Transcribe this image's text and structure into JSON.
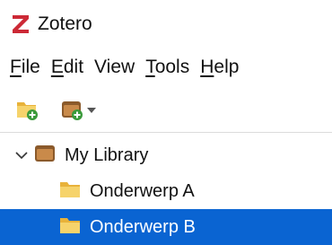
{
  "window": {
    "title": "Zotero",
    "logo_letter": "Z",
    "logo_color": "#cc2936"
  },
  "menubar": {
    "items": [
      {
        "label": "File",
        "accel": "F",
        "rest": "ile"
      },
      {
        "label": "Edit",
        "accel": "E",
        "rest": "dit"
      },
      {
        "label": "View",
        "accel": "",
        "rest": "View"
      },
      {
        "label": "Tools",
        "accel": "T",
        "rest": "ools"
      },
      {
        "label": "Help",
        "accel": "H",
        "rest": "elp"
      }
    ]
  },
  "toolbar": {
    "buttons": [
      {
        "icon": "new-collection-icon"
      },
      {
        "icon": "new-library-icon",
        "has_dropdown": true
      }
    ]
  },
  "tree": {
    "root": {
      "label": "My Library",
      "expanded": true,
      "icon": "library-icon"
    },
    "children": [
      {
        "label": "Onderwerp A",
        "icon": "folder-icon",
        "selected": false
      },
      {
        "label": "Onderwerp B",
        "icon": "folder-icon",
        "selected": true
      }
    ]
  },
  "colors": {
    "selection": "#0a64d2",
    "folder": "#f2c94c",
    "library": "#a0703a"
  }
}
